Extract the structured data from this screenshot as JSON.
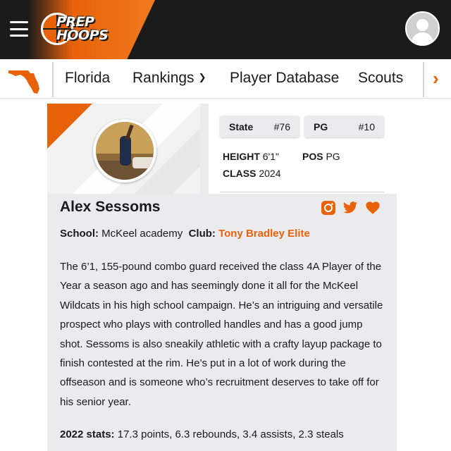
{
  "header": {
    "logo_line1": "PREP",
    "logo_line2": "HOOPS",
    "menu_icon": "hamburger-icon",
    "profile_icon": "user-avatar-icon",
    "brand_color": "#e8620a",
    "header_bg": "#1b1b1b"
  },
  "nav": {
    "state_icon": "florida-state-icon",
    "items": [
      {
        "label": "Florida",
        "has_dropdown": false
      },
      {
        "label": "Rankings",
        "has_dropdown": true
      },
      {
        "label": "Player Database",
        "has_dropdown": false
      },
      {
        "label": "Scouts",
        "has_dropdown": false
      }
    ],
    "more_icon": "chevron-right-icon"
  },
  "player": {
    "name": "Alex Sessoms",
    "state_label": "State",
    "state_rank": "#76",
    "position_label": "PG",
    "position_rank": "#10",
    "height_label": "HEIGHT",
    "height": "6'1\"",
    "pos_label": "POS",
    "pos": "PG",
    "class_label": "CLASS",
    "class_year": "2024",
    "school_label": "School:",
    "school": "McKeel academy",
    "club_label": "Club:",
    "club": "Tony Bradley Elite",
    "social_icons": [
      "instagram-icon",
      "twitter-icon",
      "heart-icon"
    ],
    "bio": "The 6’1, 155-pound combo guard received the class 4A Player of the Year a season ago and has seemingly done it all for the McKeel Wildcats in his high school campaign. He’s an intriguing and versatile prospect who plays with controlled handles and has a good jump shot. Sessoms is also sneakily athletic with a crafty layup package to finish contested at the rim. He’s put in a lot of work during the offseason and is someone who’s recruitment deserves to take off for his senior year.",
    "stats_label": "2022 stats:",
    "stats": "17.3 points, 6.3 rebounds, 3.4 assists, 2.3 steals"
  }
}
